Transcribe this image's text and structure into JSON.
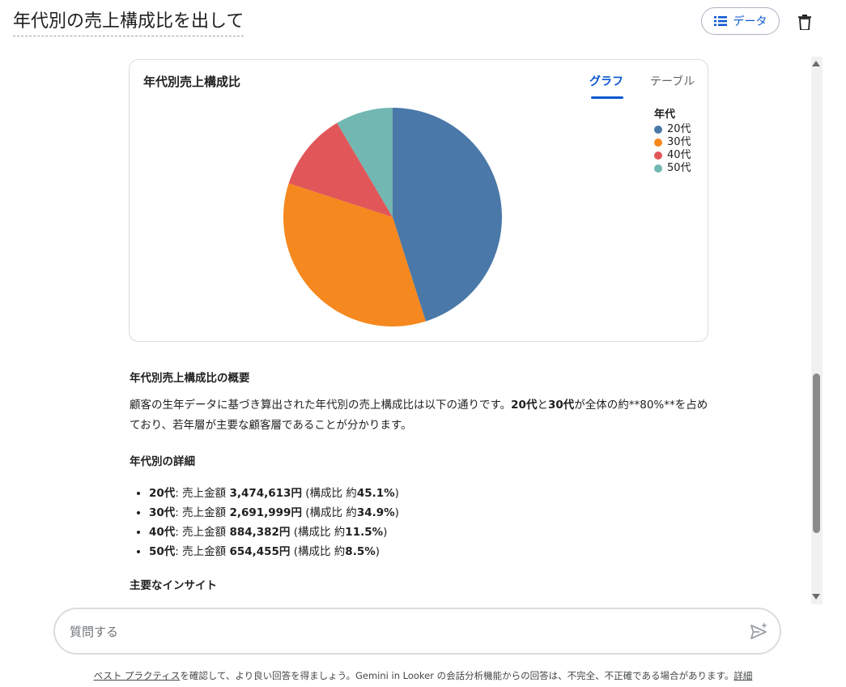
{
  "header": {
    "title": "年代別の売上構成比を出して",
    "data_button_label": "データ"
  },
  "card": {
    "title": "年代別売上構成比",
    "tabs": [
      {
        "label": "グラフ",
        "active": true
      },
      {
        "label": "テーブル",
        "active": false
      }
    ],
    "legend_title": "年代"
  },
  "chart_data": {
    "type": "pie",
    "title": "年代別売上構成比",
    "categories": [
      "20代",
      "30代",
      "40代",
      "50代"
    ],
    "values": [
      45.1,
      34.9,
      11.5,
      8.5
    ],
    "colors": [
      "#4a78a8",
      "#f5881e",
      "#e15759",
      "#72b7b2"
    ],
    "legend_position": "top-right"
  },
  "summary": {
    "heading": "年代別売上構成比の概要",
    "para_a": "顧客の生年データに基づき算出された年代別の売上構成比は以下の通りです。",
    "para_b1": "20代",
    "para_c": "と",
    "para_b2": "30代",
    "para_d": "が全体の約**80%**を占めており、若年層が主要な顧客層であることが分かります。",
    "detail_heading": "年代別の詳細",
    "items": [
      {
        "age": "20代",
        "sep": ": 売上金額 ",
        "amount": "3,474,613円",
        "ratio_pre": " (構成比 約",
        "ratio": "45.1%",
        "ratio_post": ")"
      },
      {
        "age": "30代",
        "sep": ": 売上金額 ",
        "amount": "2,691,999円",
        "ratio_pre": " (構成比 約",
        "ratio": "34.9%",
        "ratio_post": ")"
      },
      {
        "age": "40代",
        "sep": ": 売上金額 ",
        "amount": "884,382円",
        "ratio_pre": " (構成比 約",
        "ratio": "11.5%",
        "ratio_post": ")"
      },
      {
        "age": "50代",
        "sep": ": 売上金額 ",
        "amount": "654,455円",
        "ratio_pre": " (構成比 約",
        "ratio": "8.5%",
        "ratio_post": ")"
      }
    ],
    "insight_heading": "主要なインサイト"
  },
  "ask": {
    "placeholder": "質問する"
  },
  "footer": {
    "link_text": "ベスト プラクティス",
    "text": "を確認して、より良い回答を得ましょう。Gemini in Looker の会話分析機能からの回答は、不完全、不正確である場合があります。",
    "detail_link": "詳細"
  },
  "icons": {
    "data": "list-icon",
    "delete": "trash-icon",
    "send": "send-sparkle-icon"
  }
}
